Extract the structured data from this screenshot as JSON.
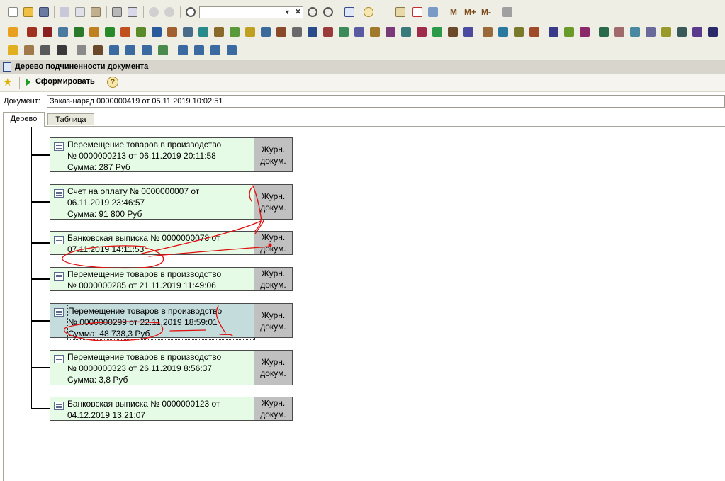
{
  "window": {
    "title": "Дерево подчиненности документа"
  },
  "toolbar": {
    "search_value": "",
    "memory_buttons": [
      "M",
      "M+",
      "M-"
    ]
  },
  "command_bar": {
    "generate_label": "Сформировать",
    "help_label": "?"
  },
  "document": {
    "label": "Документ:",
    "value": "Заказ-наряд 0000000419 от 05.11.2019 10:02:51"
  },
  "tabs": [
    {
      "label": "Дерево"
    },
    {
      "label": "Таблица"
    }
  ],
  "tree": {
    "journal_label_line1": "Журн.",
    "journal_label_line2": "докум.",
    "nodes": [
      {
        "lines": [
          "Перемещение товаров в производство",
          "№ 0000000213 от 06.11.2019 20:11:58",
          "Сумма: 287 Руб"
        ]
      },
      {
        "lines": [
          "Счет на оплату № 0000000007 от",
          "06.11.2019 23:46:57",
          "Сумма: 91 800 Руб"
        ]
      },
      {
        "lines": [
          "Банковская выписка № 0000000078 от",
          "07.11.2019 14:11:53"
        ]
      },
      {
        "lines": [
          "Перемещение товаров в производство",
          "№ 0000000285 от 21.11.2019 11:49:06"
        ]
      },
      {
        "lines": [
          "Перемещение товаров в производство",
          "№ 0000000299 от 22.11.2019 18:59:01",
          "Сумма: 48 738,3 Руб"
        ],
        "selected": true
      },
      {
        "lines": [
          "Перемещение товаров в производство",
          "№ 0000000323 от 26.11.2019 8:56:37",
          "Сумма: 3,8 Руб"
        ]
      },
      {
        "lines": [
          "Банковская выписка № 0000000123 от",
          "04.12.2019 13:21:07"
        ]
      }
    ]
  },
  "colors": {
    "node_bg": "#e6fbe6",
    "node_selected_bg": "#c4dcdc",
    "annotation": "#e01010"
  }
}
